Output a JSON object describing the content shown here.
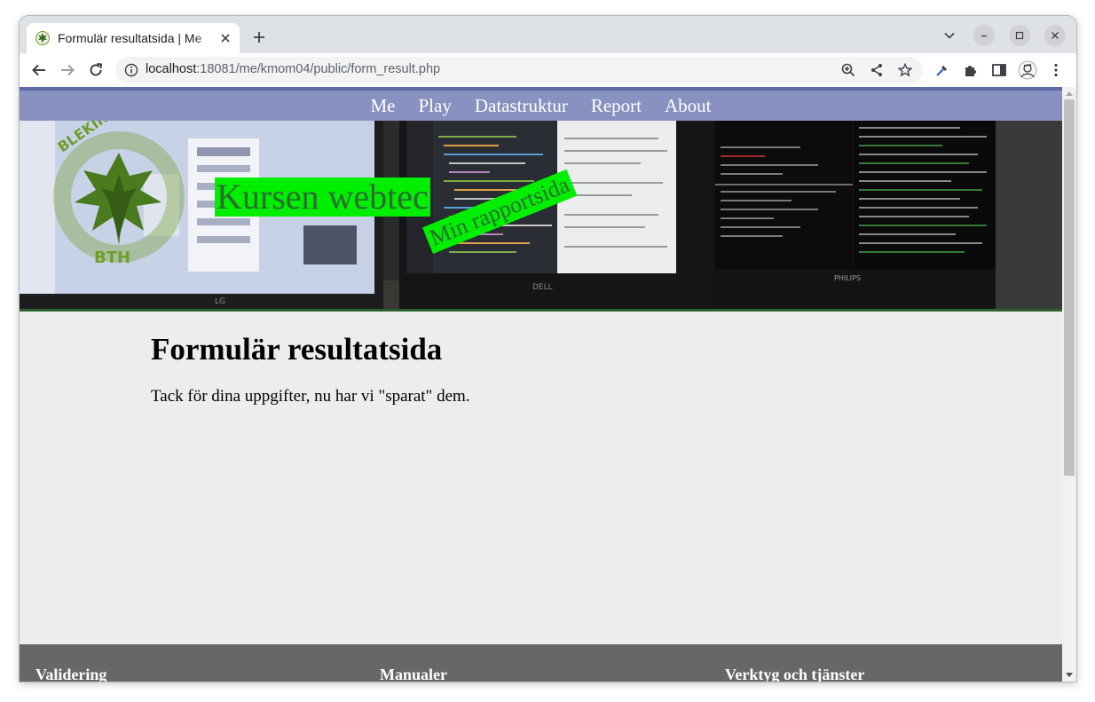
{
  "browser": {
    "tab_title": "Formulär resultatsida | Me",
    "url_host": "localhost",
    "url_rest": ":18081/me/kmom04/public/form_result.php"
  },
  "nav": {
    "items": [
      {
        "label": "Me"
      },
      {
        "label": "Play"
      },
      {
        "label": "Datastruktur"
      },
      {
        "label": "Report"
      },
      {
        "label": "About"
      }
    ]
  },
  "banner": {
    "site_title": "Kursen webtec",
    "slogan": "Min rapportsida",
    "logo_text": "BLEKINGE TEKNISKA HÖGSKOLA",
    "logo_abbr": "BTH",
    "monitor_brands": [
      "LG",
      "DELL",
      "PHILIPS"
    ]
  },
  "main": {
    "heading": "Formulär resultatsida",
    "text": "Tack för dina uppgifter, nu har vi \"sparat\" dem."
  },
  "footer": {
    "col1": "Validering",
    "col2": "Manualer",
    "col3": "Verktyg och tjänster"
  },
  "colors": {
    "nav_bg": "#8891bf",
    "title_bg": "#00ee00",
    "title_fg": "#2a6d32",
    "page_bg": "#ededed",
    "footer_bg": "#676767"
  }
}
